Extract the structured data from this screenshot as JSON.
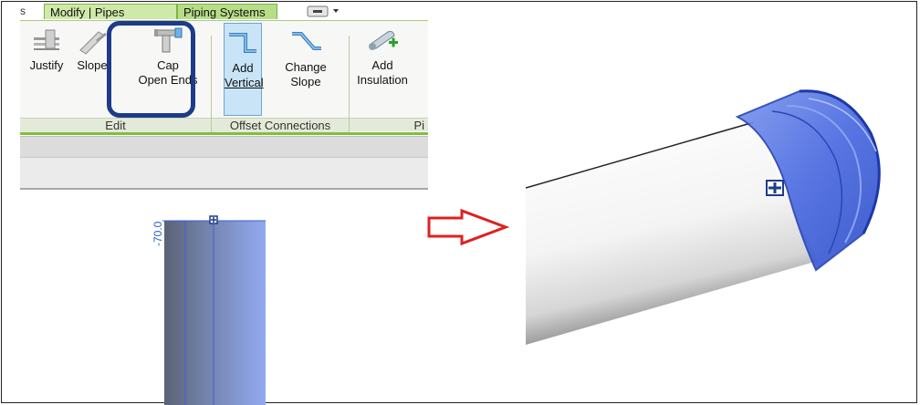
{
  "ribbon": {
    "tabs": [
      {
        "label": "Modify | Pipes"
      },
      {
        "label": "Piping Systems"
      }
    ],
    "buttons": {
      "justify": "Justify",
      "slope": "Slope",
      "cap_line1": "Cap",
      "cap_line2": "Open Ends",
      "add_vertical_line1": "Add",
      "add_vertical_line2": "Vertical",
      "change_slope_line1": "Change",
      "change_slope_line2": "Slope",
      "add_insulation_line1": "Add",
      "add_insulation_line2": "Insulation"
    },
    "groups": {
      "edit": "Edit",
      "offset_connections": "Offset Connections",
      "piping": "Pi"
    }
  },
  "plan_view": {
    "dimension": "-70.0"
  },
  "colors": {
    "highlight": "#1d3b8a",
    "arrow": "#e02020",
    "cap_blue": "#3d5fd6"
  }
}
